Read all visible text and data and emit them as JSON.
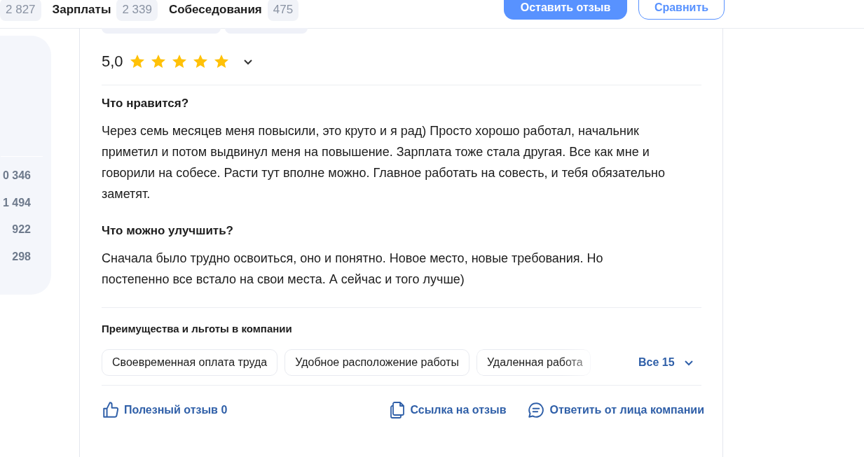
{
  "top_tabs": [
    {
      "count": "2 827"
    },
    {
      "label": "Зарплаты",
      "count": "2 339"
    },
    {
      "label": "Собеседования",
      "count": "475"
    }
  ],
  "top_buttons": [
    {
      "label": "Оставить отзыв",
      "kind": "primary"
    },
    {
      "label": "Сравнить",
      "kind": "outline"
    }
  ],
  "side_counts": [
    "0 346",
    "1 494",
    "922",
    "298"
  ],
  "review": {
    "rating": "5,0",
    "stars": 5,
    "sections": [
      {
        "title": "Что нравится?",
        "text": "Через семь месяцев меня повысили, это круто и я рад) Просто хорошо работал, начальник приметил и потом выдвинул меня на повышение. Зарплата тоже стала другая. Все как мне и говорили на собесе. Расти тут вполне можно. Главное работать на совесть, и тебя обязательно заметят."
      },
      {
        "title": "Что можно улучшить?",
        "text": "Сначала было трудно освоиться, оно и понятно. Новое место, новые требования. Но постепенно все встало на свои места. А сейчас и того лучше)"
      }
    ],
    "benefits_title": "Преимущества и льготы в компании",
    "benefits": [
      "Своевременная оплата труда",
      "Удобное расположение работы",
      "Удаленная работа"
    ],
    "benefits_more": "Все 15",
    "actions": [
      {
        "kind": "like",
        "label": "Полезный отзыв 0"
      },
      {
        "kind": "copy",
        "label": "Ссылка на отзыв"
      },
      {
        "kind": "reply",
        "label": "Ответить от лица компании"
      }
    ]
  }
}
